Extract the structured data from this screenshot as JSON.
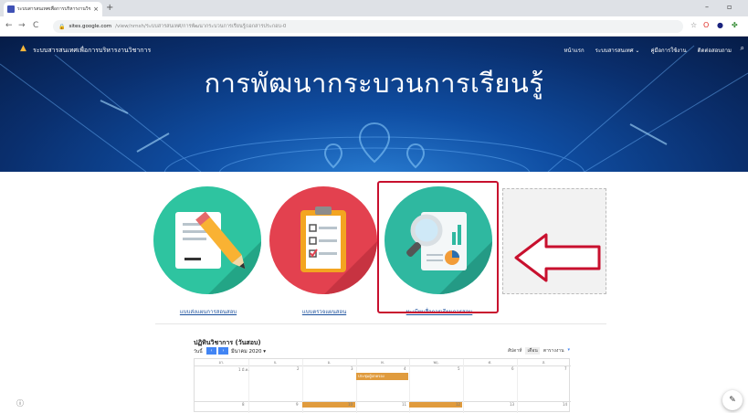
{
  "browser": {
    "tab_title": "ระบบสารสนเทศเพื่อการบริหารงานวิชา...",
    "tab_close": "×",
    "new_tab": "+",
    "url_host": "sites.google.com",
    "url_path": "/view/nrnsh/ระบบสารสนเทศ/การพัฒนากระบวนการเรียนรู้/เอกสารประกอบ-0",
    "minimize": "–",
    "maximize": "▫"
  },
  "site": {
    "name": "ระบบสารสนเทศเพื่อการบริหารงานวิชาการ",
    "nav": [
      "หน้าแรก",
      "ระบบสารสนเทศ ⌄",
      "คู่มือการใช้งาน",
      "ติดต่อสอบถาม"
    ],
    "page_title": "การพัฒนากระบวนการเรียนรู้"
  },
  "cards": [
    {
      "label": "แบบส่งแผนการสอนสอบ"
    },
    {
      "label": "แบบตรวจแผนสอน"
    },
    {
      "label": "ทะเบียนสื่อการเรียนการสอน"
    }
  ],
  "calendar": {
    "title": "ปฏิทินวิชาการ (วันสอบ)",
    "today": "วันนี้",
    "prev": "‹",
    "next": "›",
    "month": "มีนาคม 2020 ▾",
    "views": [
      "สัปดาห์",
      "เดือน",
      "ตารางงาน"
    ],
    "days": [
      "อา.",
      "จ.",
      "อ.",
      "พ.",
      "พฤ.",
      "ศ.",
      "ส."
    ],
    "week1_dates": [
      "1 มี.ค.",
      "2",
      "3",
      "4",
      "5",
      "6",
      "7"
    ],
    "week2_dates": [
      "8",
      "9",
      "10",
      "11",
      "12",
      "13",
      "14"
    ],
    "event": "ประชุมผู้ปกครอง"
  },
  "colors": {
    "highlight": "#c8102e",
    "card1": "#2ec4a0",
    "card2": "#e3414f",
    "card3": "#2fb8a0",
    "banner": "#0f4ea3"
  }
}
